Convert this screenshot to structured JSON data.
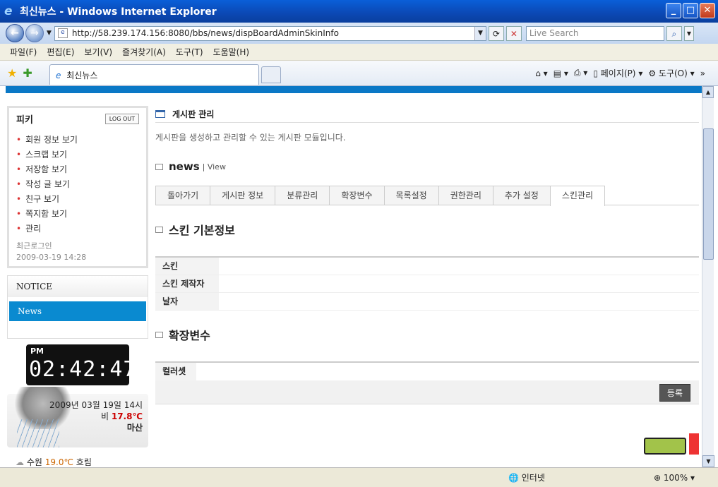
{
  "window": {
    "title": "최신뉴스 - Windows Internet Explorer"
  },
  "address": {
    "url": "http://58.239.174.156:8080/bbs/news/dispBoardAdminSkinInfo",
    "search_placeholder": "Live Search"
  },
  "menu": [
    "파일(F)",
    "편집(E)",
    "보기(V)",
    "즐겨찾기(A)",
    "도구(T)",
    "도움말(H)"
  ],
  "tab": {
    "label": "최신뉴스"
  },
  "toolbar": {
    "page": "페이지(P)",
    "tools": "도구(O)"
  },
  "sidebar": {
    "user": "피키",
    "logout": "LOG OUT",
    "items": [
      "회원 정보 보기",
      "스크랩 보기",
      "저장함 보기",
      "작성 글 보기",
      "친구 보기",
      "쪽지함 보기",
      "관리"
    ],
    "last_login_label": "최근로그인",
    "last_login": "2009-03-19 14:28",
    "notice": "NOTICE",
    "news": "News",
    "clock_ampm": "PM",
    "clock_time": "02:42:47",
    "weather_date": "2009년 03월 19일 14시",
    "weather_desc": "비",
    "weather_temp": "17.8℃",
    "weather_city": "마산",
    "city_name": "수원",
    "city_temp": "19.0℃",
    "city_cond": "흐림"
  },
  "main": {
    "page_title": "게시판 관리",
    "desc": "게시판을 생성하고 관리할 수 있는 게시판 모듈입니다.",
    "module": "news",
    "module_view": "| View",
    "tabs": [
      "돌아가기",
      "게시판 정보",
      "분류관리",
      "확장변수",
      "목록설정",
      "권한관리",
      "추가 설정",
      "스킨관리"
    ],
    "section1": "스킨 기본정보",
    "rows1": [
      "스킨",
      "스킨 제작자",
      "날자"
    ],
    "section2": "확장변수",
    "rows2": [
      "컬러셋"
    ],
    "register": "등록"
  },
  "status": {
    "zone": "인터넷",
    "zoom": "100%"
  }
}
